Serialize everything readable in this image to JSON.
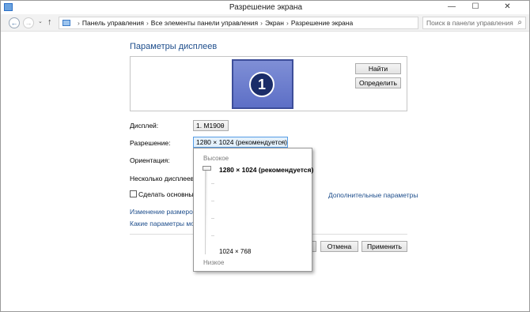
{
  "window": {
    "title": "Разрешение экрана",
    "min_glyph": "—",
    "max_glyph": "☐",
    "close_glyph": "✕"
  },
  "addressbar": {
    "back_glyph": "←",
    "forward_glyph": "→",
    "up_glyph": "↑",
    "dropdown_glyph": "⌄",
    "refresh_glyph": "↻",
    "breadcrumbs": [
      "Панель управления",
      "Все элементы панели управления",
      "Экран",
      "Разрешение экрана"
    ],
    "separator": "›",
    "search_placeholder": "Поиск в панели управления",
    "search_glyph": "⌕"
  },
  "main": {
    "heading": "Параметры дисплеев",
    "monitor_number": "1",
    "find_button": "Найти",
    "identify_button": "Определить",
    "display_label": "Дисплей:",
    "display_value": "1. M1900",
    "resolution_label": "Разрешение:",
    "resolution_value": "1280 × 1024 (рекомендуется)",
    "orientation_label": "Ориентация:",
    "multiple_displays_label": "Несколько дисплеев:",
    "primary_checkbox_label": "Сделать основным д",
    "advanced_link": "Дополнительные параметры",
    "resize_link": "Изменение размеров те",
    "which_link": "Какие параметры мони",
    "ok_button": "",
    "cancel_button": "Отмена",
    "apply_button": "Применить",
    "select_arrow": "⌄"
  },
  "resolution_popup": {
    "high_label": "Высокое",
    "low_label": "Низкое",
    "selected_resolution": "1280 × 1024 (рекомендуется)",
    "lowest_resolution": "1024 × 768",
    "slider_level": 1.0
  }
}
